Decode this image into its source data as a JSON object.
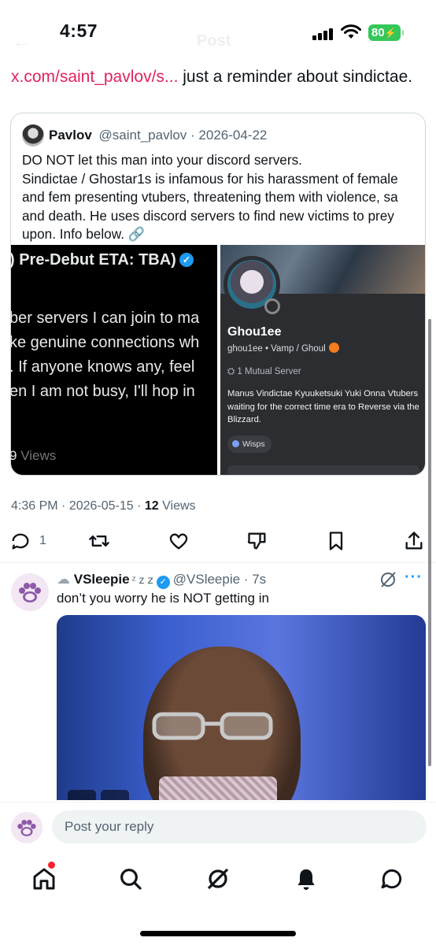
{
  "status_bar": {
    "time": "4:57",
    "battery": "80",
    "header_back_ghost": "←",
    "header_title_ghost": "Post"
  },
  "post": {
    "link_text": "x.com/saint_pavlov/s...",
    "text": " just a reminder about sindictae."
  },
  "quote": {
    "name": "Pavlov",
    "handle": "@saint_pavlov",
    "date": "2026-04-22",
    "body": "DO NOT let this man into your discord servers.\nSindictae / Ghostar1s is infamous for his harassment of female and fem presenting vtubers, threatening them with violence, sa and death. He uses discord servers to find new victims to prey upon. Info below. 🔗",
    "left_image": {
      "header": ") Pre-Debut ETA: TBA)",
      "line1": "ber servers I can join to ma",
      "line2": "ke genuine connections wh",
      "line3": ". If anyone knows any, feel",
      "line4": "en I am not busy, I'll hop in",
      "views_count": "9",
      "views_label": "Views"
    },
    "right_image": {
      "display_name": "Ghou1ee",
      "subtitle": "ghou1ee • Vamp / Ghoul",
      "mutual": "1 Mutual Server",
      "bio": "Manus Vindictae Kyuuketsuki Yuki Onna Vtubers waiting for the correct time era to Reverse via the Blizzard.",
      "tag": "Wisps"
    }
  },
  "meta": {
    "time": "4:36 PM",
    "date": "2026-05-15",
    "views_count": "12",
    "views_label": "Views"
  },
  "actions": {
    "reply_count": "1",
    "icons": [
      "reply-icon",
      "repost-icon",
      "like-icon",
      "grok-icon",
      "bookmark-icon",
      "share-icon"
    ]
  },
  "reply": {
    "name": "VSleepie",
    "name_symbols": "ᶻ z 𝗓",
    "handle": "@VSleepie",
    "age": "7s",
    "text": "don’t you worry he is NOT getting in",
    "more": "···"
  },
  "compose": {
    "placeholder": "Post your reply"
  },
  "tab_bar": {
    "items": [
      "home-icon",
      "search-icon",
      "grok-icon",
      "notifications-icon",
      "messages-icon"
    ]
  },
  "colors": {
    "link": "#e0245e",
    "verified": "#1d9bf0",
    "secondary_text": "#536471",
    "battery": "#34c759"
  }
}
